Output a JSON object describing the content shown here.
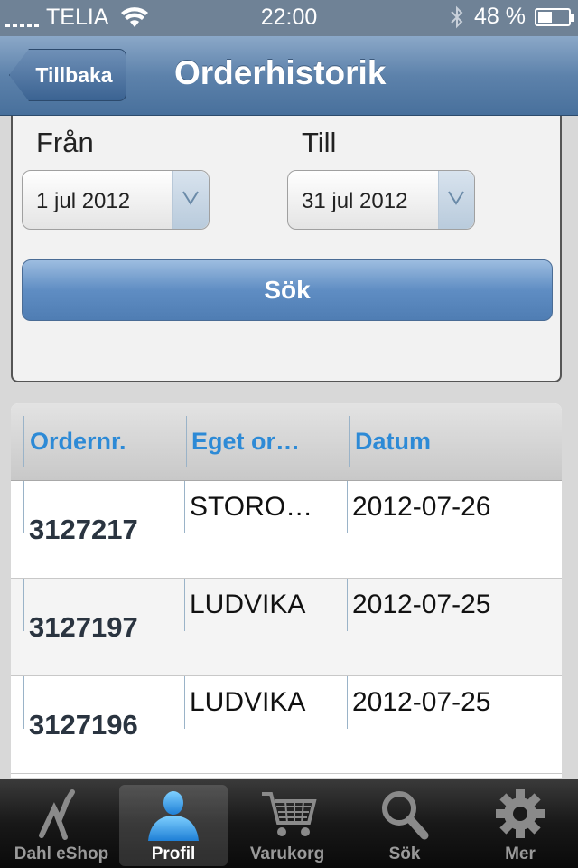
{
  "status_bar": {
    "carrier": "TELIA",
    "time": "22:00",
    "battery": "48 %",
    "battery_level": 0.48
  },
  "nav": {
    "back_label": "Tillbaka",
    "title": "Orderhistorik"
  },
  "filters": {
    "from_label": "Från",
    "from_value": "1 jul 2012",
    "to_label": "Till",
    "to_value": "31 jul 2012",
    "search_label": "Sök"
  },
  "table": {
    "headers": [
      "Ordernr.",
      "Eget or…",
      "Datum"
    ],
    "rows": [
      {
        "order": "3127217",
        "own_ref": "STORO…",
        "date": "2012-07-26"
      },
      {
        "order": "3127197",
        "own_ref": "LUDVIKA",
        "date": "2012-07-25"
      },
      {
        "order": "3127196",
        "own_ref": "LUDVIKA",
        "date": "2012-07-25"
      }
    ]
  },
  "tabbar": {
    "tabs": [
      {
        "label": "Dahl eShop",
        "icon": "dahl-logo-icon"
      },
      {
        "label": "Profil",
        "icon": "person-icon"
      },
      {
        "label": "Varukorg",
        "icon": "cart-icon"
      },
      {
        "label": "Sök",
        "icon": "search-icon"
      },
      {
        "label": "Mer",
        "icon": "gear-icon"
      }
    ],
    "active": "Profil"
  }
}
